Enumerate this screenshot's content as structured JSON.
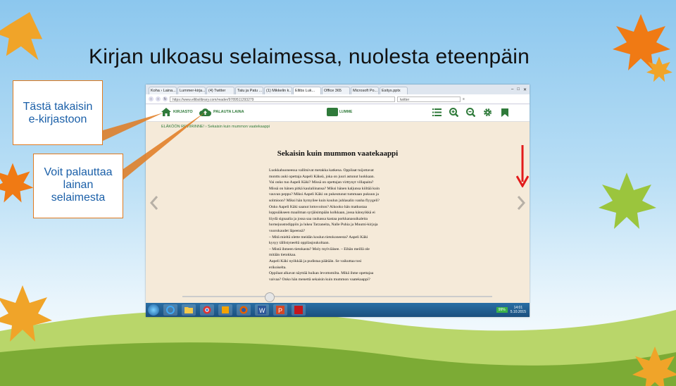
{
  "slide": {
    "title": "Kirjan ulkoasu selaimessa, nuolesta eteenpäin",
    "callout_back": [
      "Tästä takaisin",
      "e-kirjastoon"
    ],
    "callout_return": [
      "Voit palauttaa",
      "lainan",
      "selaimesta"
    ]
  },
  "browser": {
    "tabs": [
      "Koha › Laina...",
      "Lummer-kirja...",
      "(4) Twitter",
      "Tatu ja Patu ...",
      "(1) Mikkelin k...",
      "Ellibs Luk...",
      "Office 365",
      "Microsoft Po...",
      "Esitys.pptx"
    ],
    "active_tab_index": 5,
    "window_controls": [
      "–",
      "□",
      "✕"
    ],
    "url": "https://www.ellibslibrary.com/reader/9789511293279",
    "search_value": "twitter"
  },
  "app": {
    "library_label": "KIRJASTO",
    "return_label": "PALAUTA LAINA",
    "logo_text": "LUMME",
    "toolbar_icons": [
      "list-icon",
      "zoom-in-icon",
      "zoom-out-icon",
      "settings-icon",
      "bookmark-icon"
    ],
    "breadcrumb": [
      "ELÄKÖÖN REVIIRINNE!",
      "Sekaisin kuin mummon vaatekaappi"
    ]
  },
  "book": {
    "chapter_title": "Sekaisin kuin mummon vaatekaappi",
    "lines": [
      "Luokkahuoneessa vallitsivat metakka katkena. Oppilaat tuijottavat",
      "monttu auki opettaja Aapeli Käkeä, joka on juuri astunut luokkaan.",
      "   Vai onko tuo Aapeli Käki? Missä on opettajan virttynyt villapaita?",
      "Missä on hänen pitkä kaulaliinansa? Miksi hänen kaljunsa kiiltää kuin",
      "vauvan peppu? Miksi Aapeli Käki on pukeutunut tummaan pukuun ja",
      "solmioon? Miksi hän hymyilee kuin koulun juhlasalin vanha flyygeli?",
      "Onko Aapeli Käki saanut lottovoiton? Aikooko hän matkustaa",
      "loppuiäkseen maailman syrjäisimpään kolkkaan, jossa känsyikkä ei",
      "löydä signaalia ja jossa saa rauhassa kastaa porkkanasuikaleita",
      "hornejuustodippiin ja lukea Tarzaneita, Nalle Puhia ja Muumi-kirjoja",
      "vuorokaudet läpeensä?",
      "   – Mitä mieltä olette meidän koulun tietokoneesta? Aapeli Käki",
      "kysyy tällistyneeltä oppilasjoukoltaan.",
      "   – Mistä ihmeen tietokasta? Moly mylviäisee. – Eihän meillä ole",
      "mitään tietokkaa.",
      "   Aapeli Käki nyökkää ja pudistaa päätään. Se vaikuttaa tosi",
      "erikoiselta.",
      "   Oppilaat alkavat näyttää huikan levottomilta. Mikä ihme opettajaa",
      "vaivaa? Onko hän menettä sekaisin kuin mummon vaatekaappi?"
    ],
    "reading_progress": 0.28
  },
  "taskbar": {
    "battery": "99%",
    "time": "14:01",
    "date": "5.10.2015"
  },
  "colors": {
    "accent_green": "#2f7a3a",
    "callout_border": "#e07a1f",
    "callout_text": "#1a5fa8",
    "arrow_red": "#e21b1b"
  }
}
